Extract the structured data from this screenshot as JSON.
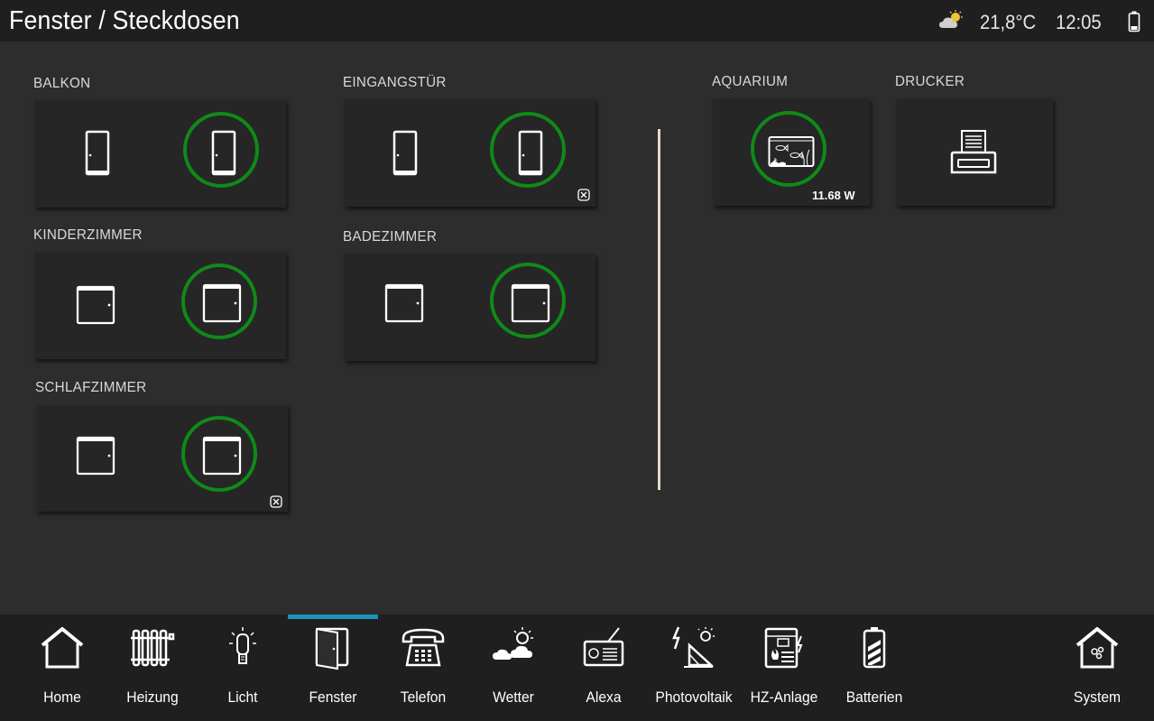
{
  "header": {
    "title": "Fenster / Steckdosen",
    "weather_icon": "cloud-sun-icon",
    "temperature": "21,8°C",
    "time": "12:05",
    "battery_icon": "battery-icon"
  },
  "rooms": {
    "balkon": {
      "label": "BALKON",
      "icon": "door-icon"
    },
    "eingangstuer": {
      "label": "EINGANGSTÜR",
      "icon": "door-icon"
    },
    "kinderzimmer": {
      "label": "KINDERZIMMER",
      "icon": "window-icon"
    },
    "badezimmer": {
      "label": "BADEZIMMER",
      "icon": "window-icon"
    },
    "schlafzimmer": {
      "label": "SCHLAFZIMMER",
      "icon": "window-icon"
    }
  },
  "sockets": {
    "aquarium": {
      "label": "AQUARIUM",
      "power": "11.68 W",
      "icon": "aquarium-icon"
    },
    "drucker": {
      "label": "DRUCKER",
      "icon": "printer-icon"
    }
  },
  "colors": {
    "ring": "#0f8a18",
    "accent": "#1c93b5",
    "background": "#2d2d2d",
    "tile": "#262626"
  },
  "nav": {
    "active": "Fenster",
    "items": [
      {
        "label": "Home",
        "icon": "house-icon"
      },
      {
        "label": "Heizung",
        "icon": "radiator-icon"
      },
      {
        "label": "Licht",
        "icon": "bulb-icon"
      },
      {
        "label": "Fenster",
        "icon": "window-icon"
      },
      {
        "label": "Telefon",
        "icon": "telephone-icon"
      },
      {
        "label": "Wetter",
        "icon": "weather-icon"
      },
      {
        "label": "Alexa",
        "icon": "radio-icon"
      },
      {
        "label": "Photovoltaik",
        "icon": "solar-panel-icon"
      },
      {
        "label": "HZ-Anlage",
        "icon": "heating-system-icon"
      },
      {
        "label": "Batterien",
        "icon": "battery-icon"
      },
      {
        "label": "System",
        "icon": "system-house-icon"
      }
    ]
  }
}
